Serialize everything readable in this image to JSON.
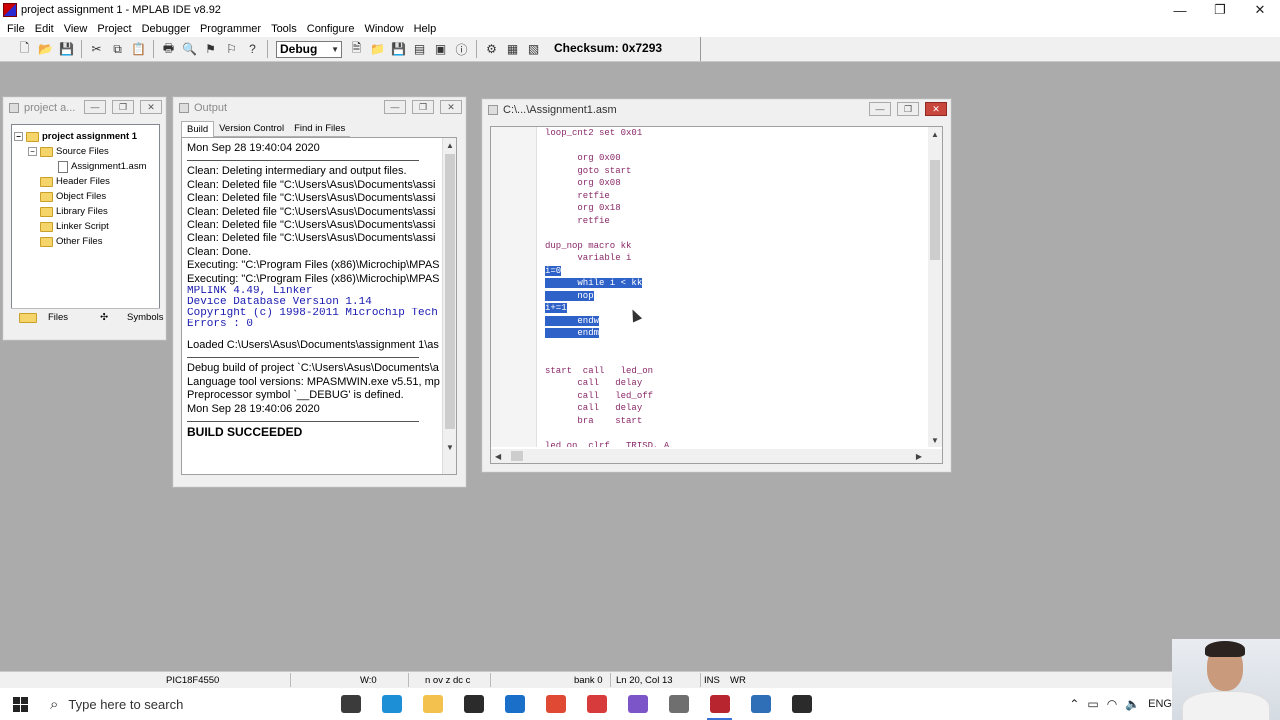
{
  "window": {
    "title": "project assignment 1 - MPLAB IDE v8.92",
    "min": "—",
    "max": "❐",
    "close": "✕"
  },
  "menu": [
    "File",
    "Edit",
    "View",
    "Project",
    "Debugger",
    "Programmer",
    "Tools",
    "Configure",
    "Window",
    "Help"
  ],
  "toolbar": {
    "config": "Debug",
    "checksum": "Checksum:  0x7293"
  },
  "project_window": {
    "title": "project a...",
    "root": "project assignment 1",
    "items": [
      {
        "label": "Source Files",
        "kind": "folder",
        "level": 1,
        "expander": "−"
      },
      {
        "label": "Assignment1.asm",
        "kind": "file",
        "level": 2
      },
      {
        "label": "Header Files",
        "kind": "folder",
        "level": 1
      },
      {
        "label": "Object Files",
        "kind": "folder",
        "level": 1
      },
      {
        "label": "Library Files",
        "kind": "folder",
        "level": 1
      },
      {
        "label": "Linker Script",
        "kind": "folder",
        "level": 1
      },
      {
        "label": "Other Files",
        "kind": "folder",
        "level": 1
      }
    ],
    "tabs": [
      "Files",
      "Symbols"
    ]
  },
  "output_window": {
    "title": "Output",
    "tabs": [
      "Build",
      "Version Control",
      "Find in Files"
    ],
    "block1": [
      "Mon Sep 28 19:40:04 2020"
    ],
    "block2": [
      "Clean: Deleting intermediary and output files.",
      "Clean: Deleted file \"C:\\Users\\Asus\\Documents\\assi",
      "Clean: Deleted file \"C:\\Users\\Asus\\Documents\\assi",
      "Clean: Deleted file \"C:\\Users\\Asus\\Documents\\assi",
      "Clean: Deleted file \"C:\\Users\\Asus\\Documents\\assi",
      "Clean: Deleted file \"C:\\Users\\Asus\\Documents\\assi",
      "Clean: Done.",
      "Executing: \"C:\\Program Files (x86)\\Microchip\\MPAS",
      "Executing: \"C:\\Program Files (x86)\\Microchip\\MPAS"
    ],
    "block_mono": [
      "MPLINK 4.49, Linker",
      "Device Database Version 1.14",
      "Copyright (c) 1998-2011 Microchip Tech",
      "Errors    : 0"
    ],
    "block3": [
      "Loaded C:\\Users\\Asus\\Documents\\assignment 1\\as"
    ],
    "block4": [
      "Debug build of project `C:\\Users\\Asus\\Documents\\a",
      "Language tool versions: MPASMWIN.exe v5.51, mp",
      "Preprocessor symbol `__DEBUG' is defined.",
      "Mon Sep 28 19:40:06 2020"
    ],
    "result": "BUILD SUCCEEDED"
  },
  "editor_window": {
    "title": "C:\\...\\Assignment1.asm",
    "lines": [
      {
        "text": "loop_cnt2 set 0x01"
      },
      {
        "text": ""
      },
      {
        "text": "      org 0x00"
      },
      {
        "text": "      goto start"
      },
      {
        "text": "      org 0x08"
      },
      {
        "text": "      retfie"
      },
      {
        "text": "      org 0x18"
      },
      {
        "text": "      retfie"
      },
      {
        "text": ""
      },
      {
        "text": "dup_nop macro kk"
      },
      {
        "text": "      variable i"
      },
      {
        "text": "i=0",
        "selected": true
      },
      {
        "text": "      while i < kk",
        "selected": true
      },
      {
        "text": "      nop",
        "selected": true
      },
      {
        "text": "i+=1",
        "selected": true
      },
      {
        "text": "      endw",
        "selected": true
      },
      {
        "text": "      endm",
        "selected": true
      },
      {
        "text": ""
      },
      {
        "text": ""
      },
      {
        "text": "start  call   led_on"
      },
      {
        "text": "      call   delay"
      },
      {
        "text": "      call   led_off"
      },
      {
        "text": "      call   delay"
      },
      {
        "text": "      bra    start"
      },
      {
        "text": ""
      },
      {
        "text": "led_on  clrf   TRISD, A"
      }
    ]
  },
  "statusbar": {
    "device": "PIC18F4550",
    "w": "W:0",
    "flags": "n ov z dc c",
    "bank": "bank 0",
    "position": "Ln 20, Col 13",
    "ins": "INS",
    "wr": "WR"
  },
  "taskbar": {
    "search_placeholder": "Type here to search",
    "apps": [
      {
        "name": "task-view",
        "color": "#3b3b3b"
      },
      {
        "name": "edge",
        "color": "#1d8fd6"
      },
      {
        "name": "file-explorer",
        "color": "#f2c14e"
      },
      {
        "name": "store",
        "color": "#2b2b2b"
      },
      {
        "name": "mail",
        "color": "#1a6fc8"
      },
      {
        "name": "chrome",
        "color": "#e04a35"
      },
      {
        "name": "app-gift",
        "color": "#d83b3b"
      },
      {
        "name": "app-screen",
        "color": "#7c55c8"
      },
      {
        "name": "app-bug",
        "color": "#6f6f6f"
      },
      {
        "name": "mplab",
        "color": "#b8252f"
      },
      {
        "name": "photos",
        "color": "#2e6fb8"
      },
      {
        "name": "settings",
        "color": "#2b2b2b"
      }
    ],
    "lang": "ENG"
  }
}
